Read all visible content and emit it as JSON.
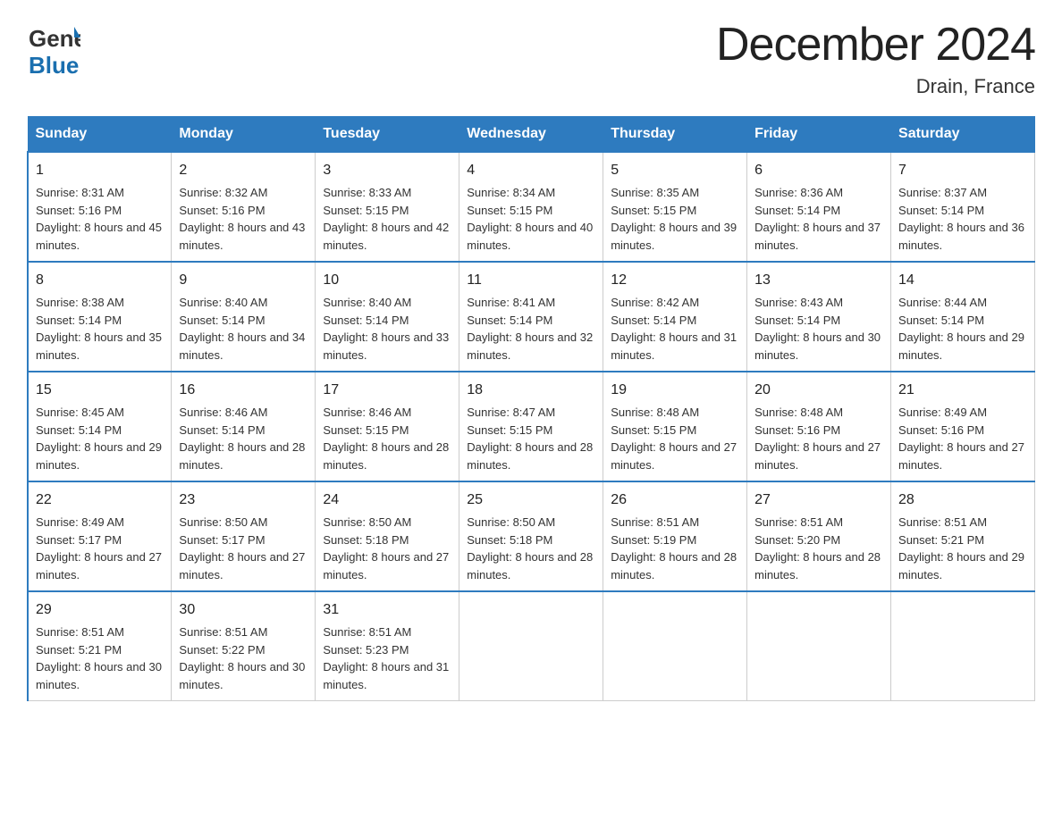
{
  "header": {
    "logo_line1": "General",
    "logo_line2": "Blue",
    "month_title": "December 2024",
    "location": "Drain, France"
  },
  "weekdays": [
    "Sunday",
    "Monday",
    "Tuesday",
    "Wednesday",
    "Thursday",
    "Friday",
    "Saturday"
  ],
  "weeks": [
    [
      {
        "day": "1",
        "sunrise": "8:31 AM",
        "sunset": "5:16 PM",
        "daylight": "8 hours and 45 minutes."
      },
      {
        "day": "2",
        "sunrise": "8:32 AM",
        "sunset": "5:16 PM",
        "daylight": "8 hours and 43 minutes."
      },
      {
        "day": "3",
        "sunrise": "8:33 AM",
        "sunset": "5:15 PM",
        "daylight": "8 hours and 42 minutes."
      },
      {
        "day": "4",
        "sunrise": "8:34 AM",
        "sunset": "5:15 PM",
        "daylight": "8 hours and 40 minutes."
      },
      {
        "day": "5",
        "sunrise": "8:35 AM",
        "sunset": "5:15 PM",
        "daylight": "8 hours and 39 minutes."
      },
      {
        "day": "6",
        "sunrise": "8:36 AM",
        "sunset": "5:14 PM",
        "daylight": "8 hours and 37 minutes."
      },
      {
        "day": "7",
        "sunrise": "8:37 AM",
        "sunset": "5:14 PM",
        "daylight": "8 hours and 36 minutes."
      }
    ],
    [
      {
        "day": "8",
        "sunrise": "8:38 AM",
        "sunset": "5:14 PM",
        "daylight": "8 hours and 35 minutes."
      },
      {
        "day": "9",
        "sunrise": "8:40 AM",
        "sunset": "5:14 PM",
        "daylight": "8 hours and 34 minutes."
      },
      {
        "day": "10",
        "sunrise": "8:40 AM",
        "sunset": "5:14 PM",
        "daylight": "8 hours and 33 minutes."
      },
      {
        "day": "11",
        "sunrise": "8:41 AM",
        "sunset": "5:14 PM",
        "daylight": "8 hours and 32 minutes."
      },
      {
        "day": "12",
        "sunrise": "8:42 AM",
        "sunset": "5:14 PM",
        "daylight": "8 hours and 31 minutes."
      },
      {
        "day": "13",
        "sunrise": "8:43 AM",
        "sunset": "5:14 PM",
        "daylight": "8 hours and 30 minutes."
      },
      {
        "day": "14",
        "sunrise": "8:44 AM",
        "sunset": "5:14 PM",
        "daylight": "8 hours and 29 minutes."
      }
    ],
    [
      {
        "day": "15",
        "sunrise": "8:45 AM",
        "sunset": "5:14 PM",
        "daylight": "8 hours and 29 minutes."
      },
      {
        "day": "16",
        "sunrise": "8:46 AM",
        "sunset": "5:14 PM",
        "daylight": "8 hours and 28 minutes."
      },
      {
        "day": "17",
        "sunrise": "8:46 AM",
        "sunset": "5:15 PM",
        "daylight": "8 hours and 28 minutes."
      },
      {
        "day": "18",
        "sunrise": "8:47 AM",
        "sunset": "5:15 PM",
        "daylight": "8 hours and 28 minutes."
      },
      {
        "day": "19",
        "sunrise": "8:48 AM",
        "sunset": "5:15 PM",
        "daylight": "8 hours and 27 minutes."
      },
      {
        "day": "20",
        "sunrise": "8:48 AM",
        "sunset": "5:16 PM",
        "daylight": "8 hours and 27 minutes."
      },
      {
        "day": "21",
        "sunrise": "8:49 AM",
        "sunset": "5:16 PM",
        "daylight": "8 hours and 27 minutes."
      }
    ],
    [
      {
        "day": "22",
        "sunrise": "8:49 AM",
        "sunset": "5:17 PM",
        "daylight": "8 hours and 27 minutes."
      },
      {
        "day": "23",
        "sunrise": "8:50 AM",
        "sunset": "5:17 PM",
        "daylight": "8 hours and 27 minutes."
      },
      {
        "day": "24",
        "sunrise": "8:50 AM",
        "sunset": "5:18 PM",
        "daylight": "8 hours and 27 minutes."
      },
      {
        "day": "25",
        "sunrise": "8:50 AM",
        "sunset": "5:18 PM",
        "daylight": "8 hours and 28 minutes."
      },
      {
        "day": "26",
        "sunrise": "8:51 AM",
        "sunset": "5:19 PM",
        "daylight": "8 hours and 28 minutes."
      },
      {
        "day": "27",
        "sunrise": "8:51 AM",
        "sunset": "5:20 PM",
        "daylight": "8 hours and 28 minutes."
      },
      {
        "day": "28",
        "sunrise": "8:51 AM",
        "sunset": "5:21 PM",
        "daylight": "8 hours and 29 minutes."
      }
    ],
    [
      {
        "day": "29",
        "sunrise": "8:51 AM",
        "sunset": "5:21 PM",
        "daylight": "8 hours and 30 minutes."
      },
      {
        "day": "30",
        "sunrise": "8:51 AM",
        "sunset": "5:22 PM",
        "daylight": "8 hours and 30 minutes."
      },
      {
        "day": "31",
        "sunrise": "8:51 AM",
        "sunset": "5:23 PM",
        "daylight": "8 hours and 31 minutes."
      },
      {
        "day": "",
        "sunrise": "",
        "sunset": "",
        "daylight": ""
      },
      {
        "day": "",
        "sunrise": "",
        "sunset": "",
        "daylight": ""
      },
      {
        "day": "",
        "sunrise": "",
        "sunset": "",
        "daylight": ""
      },
      {
        "day": "",
        "sunrise": "",
        "sunset": "",
        "daylight": ""
      }
    ]
  ]
}
